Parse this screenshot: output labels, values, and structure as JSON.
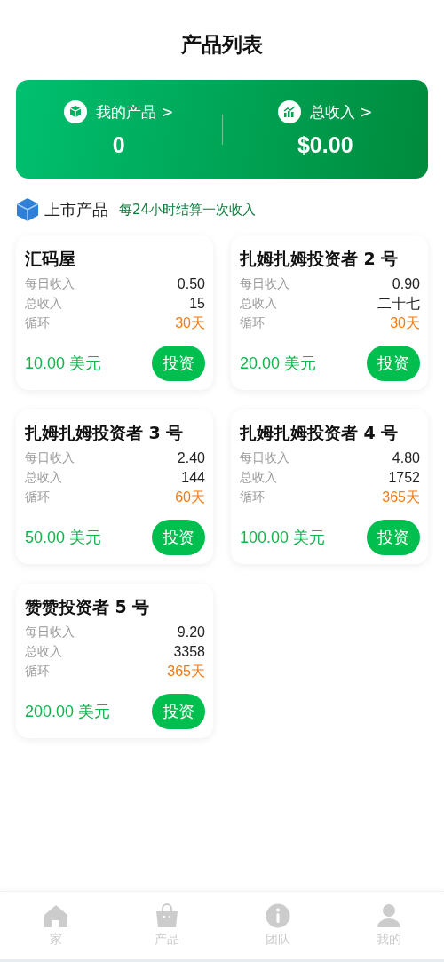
{
  "header": {
    "title": "产品列表"
  },
  "summary": [
    {
      "kind": "box",
      "label": "我的产品",
      "chevron": ">",
      "value": "0"
    },
    {
      "kind": "chart",
      "label": "总收入",
      "chevron": ">",
      "value": "$0.00"
    }
  ],
  "section": {
    "title": "上市产品",
    "note": "每24小时结算一次收入"
  },
  "products": [
    {
      "name": "汇码屋",
      "daily_label": "每日收入",
      "daily": "0.50",
      "total_label": "总收入",
      "total": "15",
      "cycle_label": "循环",
      "cycle": "30天",
      "price": "10.00 美元",
      "button": "投资"
    },
    {
      "name": "扎姆扎姆投资者 2 号",
      "daily_label": "每日收入",
      "daily": "0.90",
      "total_label": "总收入",
      "total": "二十七",
      "cycle_label": "循环",
      "cycle": "30天",
      "price": "20.00 美元",
      "button": "投资"
    },
    {
      "name": "扎姆扎姆投资者 3 号",
      "daily_label": "每日收入",
      "daily": "2.40",
      "total_label": "总收入",
      "total": "144",
      "cycle_label": "循环",
      "cycle": "60天",
      "price": "50.00 美元",
      "button": "投资"
    },
    {
      "name": "扎姆扎姆投资者 4 号",
      "daily_label": "每日收入",
      "daily": "4.80",
      "total_label": "总收入",
      "total": "1752",
      "cycle_label": "循环",
      "cycle": "365天",
      "price": "100.00 美元",
      "button": "投资"
    },
    {
      "name": "赞赞投资者 5 号",
      "daily_label": "每日收入",
      "daily": "9.20",
      "total_label": "总收入",
      "total": "3358",
      "cycle_label": "循环",
      "cycle": "365天",
      "price": "200.00 美元",
      "button": "投资"
    }
  ],
  "nav": [
    {
      "kind": "home",
      "label": "家",
      "selected": false
    },
    {
      "kind": "bag",
      "label": "产品",
      "selected": false
    },
    {
      "kind": "info",
      "label": "团队",
      "selected": false
    },
    {
      "kind": "user",
      "label": "我的",
      "selected": false
    }
  ]
}
